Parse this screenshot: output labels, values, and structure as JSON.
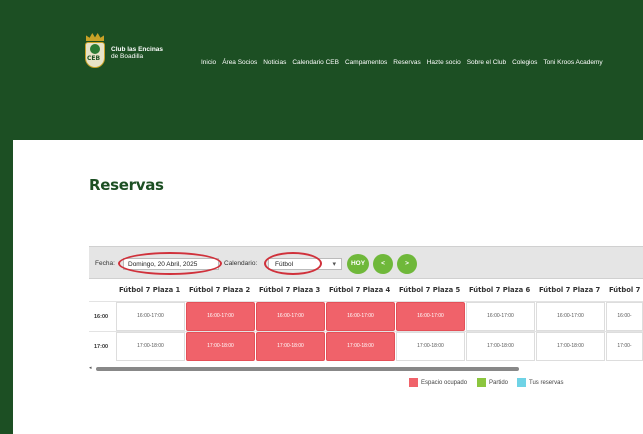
{
  "brand": {
    "line1": "Club las Encinas",
    "line2": "de Boadilla",
    "crest_text": "CEB"
  },
  "nav": [
    "Inicio",
    "Área Socios",
    "Noticias",
    "Calendario CEB",
    "Campamentos",
    "Reservas",
    "Hazte socio",
    "Sobre el Club",
    "Colegios",
    "Toni Kroos Academy"
  ],
  "page": {
    "title": "Reservas"
  },
  "toolbar": {
    "date_label": "Fecha:",
    "date_value": "Domingo, 20 Abril, 2025",
    "calendar_label": "Calendario:",
    "calendar_value": "Fútbol",
    "today_button": "HOY",
    "prev_button": "<",
    "next_button": ">"
  },
  "schedule": {
    "columns": [
      "Fútbol 7 Plaza 1",
      "Fútbol 7 Plaza 2",
      "Fútbol 7 Plaza 3",
      "Fútbol 7 Plaza 4",
      "Fútbol 7 Plaza 5",
      "Fútbol 7 Plaza 6",
      "Fútbol 7 Plaza 7",
      "Fútbol 7"
    ],
    "rows": [
      {
        "time": "16:00",
        "cells": [
          {
            "text": "16:00-17:00",
            "status": "free"
          },
          {
            "text": "16:00-17:00",
            "status": "busy"
          },
          {
            "text": "16:00-17:00",
            "status": "busy"
          },
          {
            "text": "16:00-17:00",
            "status": "busy"
          },
          {
            "text": "16:00-17:00",
            "status": "busy"
          },
          {
            "text": "16:00-17:00",
            "status": "free"
          },
          {
            "text": "16:00-17:00",
            "status": "free"
          },
          {
            "text": "16:00-",
            "status": "free"
          }
        ]
      },
      {
        "time": "17:00",
        "cells": [
          {
            "text": "17:00-18:00",
            "status": "free"
          },
          {
            "text": "17:00-18:00",
            "status": "busy"
          },
          {
            "text": "17:00-18:00",
            "status": "busy"
          },
          {
            "text": "17:00-18:00",
            "status": "busy"
          },
          {
            "text": "17:00-18:00",
            "status": "free"
          },
          {
            "text": "17:00-18:00",
            "status": "free"
          },
          {
            "text": "17:00-18:00",
            "status": "free"
          },
          {
            "text": "17:00-",
            "status": "free"
          }
        ]
      }
    ]
  },
  "legend": [
    {
      "label": "Espacio ocupado",
      "color": "#f0626a"
    },
    {
      "label": "Partido",
      "color": "#8cc63f"
    },
    {
      "label": "Tus reservas",
      "color": "#6fd3e6"
    }
  ],
  "colors": {
    "primary_green": "#1c4f23",
    "button_green": "#6fb83a",
    "busy_red": "#f0626a",
    "highlight_oval": "#d0313b"
  }
}
